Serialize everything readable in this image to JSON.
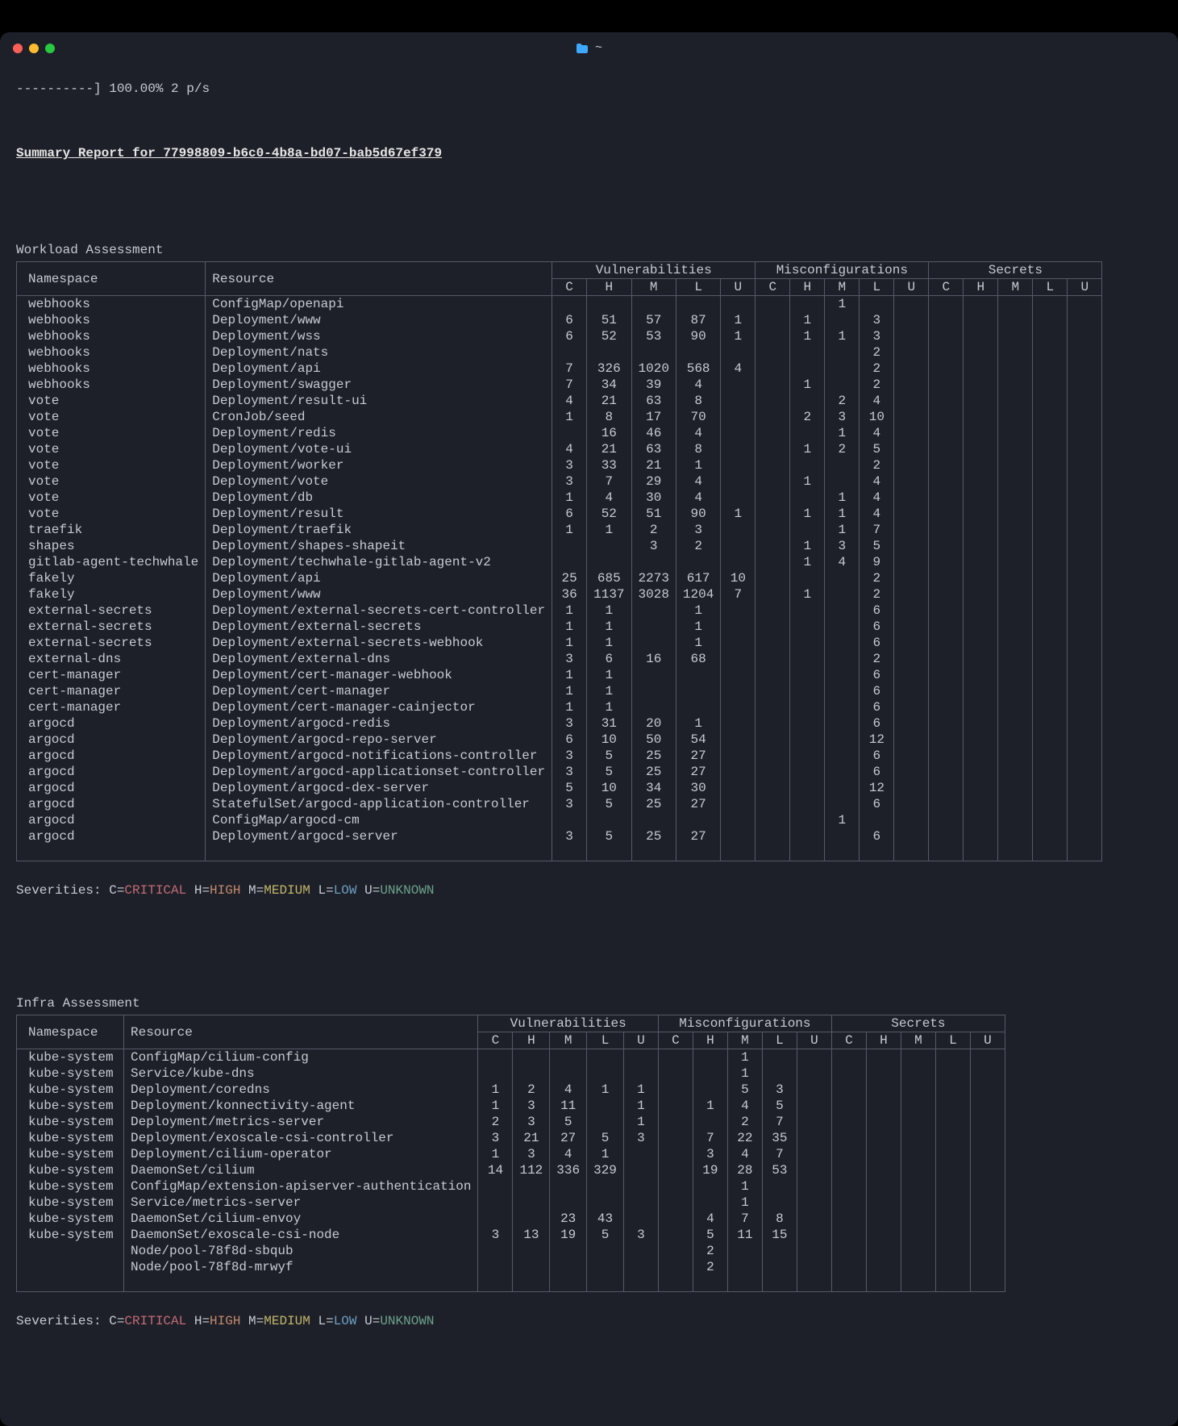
{
  "titlebar": {
    "colors": {
      "close": "#ff5f57",
      "min": "#febc2e",
      "max": "#28c840",
      "folder": "#3ea7ff"
    },
    "path": "~"
  },
  "progress_line": "----------] 100.00% 2 p/s",
  "report_title": "Summary Report for 77998809-b6c0-4b8a-bd07-bab5d67ef379",
  "workload_heading": "Workload Assessment",
  "infra_heading": "Infra Assessment",
  "headers": {
    "ns": "Namespace",
    "res": "Resource",
    "vuln": "Vulnerabilities",
    "mis": "Misconfigurations",
    "sec": "Secrets",
    "sev": [
      "C",
      "H",
      "M",
      "L",
      "U"
    ]
  },
  "legend": {
    "prefix": "Severities: ",
    "c_label": "C=",
    "c_val": "CRITICAL",
    "h_label": " H=",
    "h_val": "HIGH",
    "m_label": " M=",
    "m_val": "MEDIUM",
    "l_label": " L=",
    "l_val": "LOW",
    "u_label": " U=",
    "u_val": "UNKNOWN"
  },
  "workload_rows": [
    {
      "ns": "webhooks",
      "res": "ConfigMap/openapi",
      "v": [
        "",
        "",
        "",
        "",
        ""
      ],
      "m": [
        "",
        "",
        "1",
        "",
        ""
      ],
      "s": [
        "",
        "",
        "",
        "",
        ""
      ]
    },
    {
      "ns": "webhooks",
      "res": "Deployment/www",
      "v": [
        "6",
        "51",
        "57",
        "87",
        "1"
      ],
      "m": [
        "",
        "1",
        "",
        "3",
        ""
      ],
      "s": [
        "",
        "",
        "",
        "",
        ""
      ]
    },
    {
      "ns": "webhooks",
      "res": "Deployment/wss",
      "v": [
        "6",
        "52",
        "53",
        "90",
        "1"
      ],
      "m": [
        "",
        "1",
        "1",
        "3",
        ""
      ],
      "s": [
        "",
        "",
        "",
        "",
        ""
      ]
    },
    {
      "ns": "webhooks",
      "res": "Deployment/nats",
      "v": [
        "",
        "",
        "",
        "",
        ""
      ],
      "m": [
        "",
        "",
        "",
        "2",
        ""
      ],
      "s": [
        "",
        "",
        "",
        "",
        ""
      ]
    },
    {
      "ns": "webhooks",
      "res": "Deployment/api",
      "v": [
        "7",
        "326",
        "1020",
        "568",
        "4"
      ],
      "m": [
        "",
        "",
        "",
        "2",
        ""
      ],
      "s": [
        "",
        "",
        "",
        "",
        ""
      ]
    },
    {
      "ns": "webhooks",
      "res": "Deployment/swagger",
      "v": [
        "7",
        "34",
        "39",
        "4",
        ""
      ],
      "m": [
        "",
        "1",
        "",
        "2",
        ""
      ],
      "s": [
        "",
        "",
        "",
        "",
        ""
      ]
    },
    {
      "ns": "vote",
      "res": "Deployment/result-ui",
      "v": [
        "4",
        "21",
        "63",
        "8",
        ""
      ],
      "m": [
        "",
        "",
        "2",
        "4",
        ""
      ],
      "s": [
        "",
        "",
        "",
        "",
        ""
      ]
    },
    {
      "ns": "vote",
      "res": "CronJob/seed",
      "v": [
        "1",
        "8",
        "17",
        "70",
        ""
      ],
      "m": [
        "",
        "2",
        "3",
        "10",
        ""
      ],
      "s": [
        "",
        "",
        "",
        "",
        ""
      ]
    },
    {
      "ns": "vote",
      "res": "Deployment/redis",
      "v": [
        "",
        "16",
        "46",
        "4",
        ""
      ],
      "m": [
        "",
        "",
        "1",
        "4",
        ""
      ],
      "s": [
        "",
        "",
        "",
        "",
        ""
      ]
    },
    {
      "ns": "vote",
      "res": "Deployment/vote-ui",
      "v": [
        "4",
        "21",
        "63",
        "8",
        ""
      ],
      "m": [
        "",
        "1",
        "2",
        "5",
        ""
      ],
      "s": [
        "",
        "",
        "",
        "",
        ""
      ]
    },
    {
      "ns": "vote",
      "res": "Deployment/worker",
      "v": [
        "3",
        "33",
        "21",
        "1",
        ""
      ],
      "m": [
        "",
        "",
        "",
        "2",
        ""
      ],
      "s": [
        "",
        "",
        "",
        "",
        ""
      ]
    },
    {
      "ns": "vote",
      "res": "Deployment/vote",
      "v": [
        "3",
        "7",
        "29",
        "4",
        ""
      ],
      "m": [
        "",
        "1",
        "",
        "4",
        ""
      ],
      "s": [
        "",
        "",
        "",
        "",
        ""
      ]
    },
    {
      "ns": "vote",
      "res": "Deployment/db",
      "v": [
        "1",
        "4",
        "30",
        "4",
        ""
      ],
      "m": [
        "",
        "",
        "1",
        "4",
        ""
      ],
      "s": [
        "",
        "",
        "",
        "",
        ""
      ]
    },
    {
      "ns": "vote",
      "res": "Deployment/result",
      "v": [
        "6",
        "52",
        "51",
        "90",
        "1"
      ],
      "m": [
        "",
        "1",
        "1",
        "4",
        ""
      ],
      "s": [
        "",
        "",
        "",
        "",
        ""
      ]
    },
    {
      "ns": "traefik",
      "res": "Deployment/traefik",
      "v": [
        "1",
        "1",
        "2",
        "3",
        ""
      ],
      "m": [
        "",
        "",
        "1",
        "7",
        ""
      ],
      "s": [
        "",
        "",
        "",
        "",
        ""
      ]
    },
    {
      "ns": "shapes",
      "res": "Deployment/shapes-shapeit",
      "v": [
        "",
        "",
        "3",
        "2",
        ""
      ],
      "m": [
        "",
        "1",
        "3",
        "5",
        ""
      ],
      "s": [
        "",
        "",
        "",
        "",
        ""
      ]
    },
    {
      "ns": "gitlab-agent-techwhale",
      "res": "Deployment/techwhale-gitlab-agent-v2",
      "v": [
        "",
        "",
        "",
        "",
        ""
      ],
      "m": [
        "",
        "1",
        "4",
        "9",
        ""
      ],
      "s": [
        "",
        "",
        "",
        "",
        ""
      ]
    },
    {
      "ns": "fakely",
      "res": "Deployment/api",
      "v": [
        "25",
        "685",
        "2273",
        "617",
        "10"
      ],
      "m": [
        "",
        "",
        "",
        "2",
        ""
      ],
      "s": [
        "",
        "",
        "",
        "",
        ""
      ]
    },
    {
      "ns": "fakely",
      "res": "Deployment/www",
      "v": [
        "36",
        "1137",
        "3028",
        "1204",
        "7"
      ],
      "m": [
        "",
        "1",
        "",
        "2",
        ""
      ],
      "s": [
        "",
        "",
        "",
        "",
        ""
      ]
    },
    {
      "ns": "external-secrets",
      "res": "Deployment/external-secrets-cert-controller",
      "v": [
        "1",
        "1",
        "",
        "1",
        ""
      ],
      "m": [
        "",
        "",
        "",
        "6",
        ""
      ],
      "s": [
        "",
        "",
        "",
        "",
        ""
      ]
    },
    {
      "ns": "external-secrets",
      "res": "Deployment/external-secrets",
      "v": [
        "1",
        "1",
        "",
        "1",
        ""
      ],
      "m": [
        "",
        "",
        "",
        "6",
        ""
      ],
      "s": [
        "",
        "",
        "",
        "",
        ""
      ]
    },
    {
      "ns": "external-secrets",
      "res": "Deployment/external-secrets-webhook",
      "v": [
        "1",
        "1",
        "",
        "1",
        ""
      ],
      "m": [
        "",
        "",
        "",
        "6",
        ""
      ],
      "s": [
        "",
        "",
        "",
        "",
        ""
      ]
    },
    {
      "ns": "external-dns",
      "res": "Deployment/external-dns",
      "v": [
        "3",
        "6",
        "16",
        "68",
        ""
      ],
      "m": [
        "",
        "",
        "",
        "2",
        ""
      ],
      "s": [
        "",
        "",
        "",
        "",
        ""
      ]
    },
    {
      "ns": "cert-manager",
      "res": "Deployment/cert-manager-webhook",
      "v": [
        "1",
        "1",
        "",
        "",
        ""
      ],
      "m": [
        "",
        "",
        "",
        "6",
        ""
      ],
      "s": [
        "",
        "",
        "",
        "",
        ""
      ]
    },
    {
      "ns": "cert-manager",
      "res": "Deployment/cert-manager",
      "v": [
        "1",
        "1",
        "",
        "",
        ""
      ],
      "m": [
        "",
        "",
        "",
        "6",
        ""
      ],
      "s": [
        "",
        "",
        "",
        "",
        ""
      ]
    },
    {
      "ns": "cert-manager",
      "res": "Deployment/cert-manager-cainjector",
      "v": [
        "1",
        "1",
        "",
        "",
        ""
      ],
      "m": [
        "",
        "",
        "",
        "6",
        ""
      ],
      "s": [
        "",
        "",
        "",
        "",
        ""
      ]
    },
    {
      "ns": "argocd",
      "res": "Deployment/argocd-redis",
      "v": [
        "3",
        "31",
        "20",
        "1",
        ""
      ],
      "m": [
        "",
        "",
        "",
        "6",
        ""
      ],
      "s": [
        "",
        "",
        "",
        "",
        ""
      ]
    },
    {
      "ns": "argocd",
      "res": "Deployment/argocd-repo-server",
      "v": [
        "6",
        "10",
        "50",
        "54",
        ""
      ],
      "m": [
        "",
        "",
        "",
        "12",
        ""
      ],
      "s": [
        "",
        "",
        "",
        "",
        ""
      ]
    },
    {
      "ns": "argocd",
      "res": "Deployment/argocd-notifications-controller",
      "v": [
        "3",
        "5",
        "25",
        "27",
        ""
      ],
      "m": [
        "",
        "",
        "",
        "6",
        ""
      ],
      "s": [
        "",
        "",
        "",
        "",
        ""
      ]
    },
    {
      "ns": "argocd",
      "res": "Deployment/argocd-applicationset-controller",
      "v": [
        "3",
        "5",
        "25",
        "27",
        ""
      ],
      "m": [
        "",
        "",
        "",
        "6",
        ""
      ],
      "s": [
        "",
        "",
        "",
        "",
        ""
      ]
    },
    {
      "ns": "argocd",
      "res": "Deployment/argocd-dex-server",
      "v": [
        "5",
        "10",
        "34",
        "30",
        ""
      ],
      "m": [
        "",
        "",
        "",
        "12",
        ""
      ],
      "s": [
        "",
        "",
        "",
        "",
        ""
      ]
    },
    {
      "ns": "argocd",
      "res": "StatefulSet/argocd-application-controller",
      "v": [
        "3",
        "5",
        "25",
        "27",
        ""
      ],
      "m": [
        "",
        "",
        "",
        "6",
        ""
      ],
      "s": [
        "",
        "",
        "",
        "",
        ""
      ]
    },
    {
      "ns": "argocd",
      "res": "ConfigMap/argocd-cm",
      "v": [
        "",
        "",
        "",
        "",
        ""
      ],
      "m": [
        "",
        "",
        "1",
        "",
        ""
      ],
      "s": [
        "",
        "",
        "",
        "",
        ""
      ]
    },
    {
      "ns": "argocd",
      "res": "Deployment/argocd-server",
      "v": [
        "3",
        "5",
        "25",
        "27",
        ""
      ],
      "m": [
        "",
        "",
        "",
        "6",
        ""
      ],
      "s": [
        "",
        "",
        "",
        "",
        ""
      ]
    }
  ],
  "infra_rows": [
    {
      "ns": "kube-system",
      "res": "ConfigMap/cilium-config",
      "v": [
        "",
        "",
        "",
        "",
        ""
      ],
      "m": [
        "",
        "",
        "1",
        "",
        ""
      ],
      "s": [
        "",
        "",
        "",
        "",
        ""
      ]
    },
    {
      "ns": "kube-system",
      "res": "Service/kube-dns",
      "v": [
        "",
        "",
        "",
        "",
        ""
      ],
      "m": [
        "",
        "",
        "1",
        "",
        ""
      ],
      "s": [
        "",
        "",
        "",
        "",
        ""
      ]
    },
    {
      "ns": "kube-system",
      "res": "Deployment/coredns",
      "v": [
        "1",
        "2",
        "4",
        "1",
        "1"
      ],
      "m": [
        "",
        "",
        "5",
        "3",
        ""
      ],
      "s": [
        "",
        "",
        "",
        "",
        ""
      ]
    },
    {
      "ns": "kube-system",
      "res": "Deployment/konnectivity-agent",
      "v": [
        "1",
        "3",
        "11",
        "",
        "1"
      ],
      "m": [
        "",
        "1",
        "4",
        "5",
        ""
      ],
      "s": [
        "",
        "",
        "",
        "",
        ""
      ]
    },
    {
      "ns": "kube-system",
      "res": "Deployment/metrics-server",
      "v": [
        "2",
        "3",
        "5",
        "",
        "1"
      ],
      "m": [
        "",
        "",
        "2",
        "7",
        ""
      ],
      "s": [
        "",
        "",
        "",
        "",
        ""
      ]
    },
    {
      "ns": "kube-system",
      "res": "Deployment/exoscale-csi-controller",
      "v": [
        "3",
        "21",
        "27",
        "5",
        "3"
      ],
      "m": [
        "",
        "7",
        "22",
        "35",
        ""
      ],
      "s": [
        "",
        "",
        "",
        "",
        ""
      ]
    },
    {
      "ns": "kube-system",
      "res": "Deployment/cilium-operator",
      "v": [
        "1",
        "3",
        "4",
        "1",
        ""
      ],
      "m": [
        "",
        "3",
        "4",
        "7",
        ""
      ],
      "s": [
        "",
        "",
        "",
        "",
        ""
      ]
    },
    {
      "ns": "kube-system",
      "res": "DaemonSet/cilium",
      "v": [
        "14",
        "112",
        "336",
        "329",
        ""
      ],
      "m": [
        "",
        "19",
        "28",
        "53",
        ""
      ],
      "s": [
        "",
        "",
        "",
        "",
        ""
      ]
    },
    {
      "ns": "kube-system",
      "res": "ConfigMap/extension-apiserver-authentication",
      "v": [
        "",
        "",
        "",
        "",
        ""
      ],
      "m": [
        "",
        "",
        "1",
        "",
        ""
      ],
      "s": [
        "",
        "",
        "",
        "",
        ""
      ]
    },
    {
      "ns": "kube-system",
      "res": "Service/metrics-server",
      "v": [
        "",
        "",
        "",
        "",
        ""
      ],
      "m": [
        "",
        "",
        "1",
        "",
        ""
      ],
      "s": [
        "",
        "",
        "",
        "",
        ""
      ]
    },
    {
      "ns": "kube-system",
      "res": "DaemonSet/cilium-envoy",
      "v": [
        "",
        "",
        "23",
        "43",
        ""
      ],
      "m": [
        "",
        "4",
        "7",
        "8",
        ""
      ],
      "s": [
        "",
        "",
        "",
        "",
        ""
      ]
    },
    {
      "ns": "kube-system",
      "res": "DaemonSet/exoscale-csi-node",
      "v": [
        "3",
        "13",
        "19",
        "5",
        "3"
      ],
      "m": [
        "",
        "5",
        "11",
        "15",
        ""
      ],
      "s": [
        "",
        "",
        "",
        "",
        ""
      ]
    },
    {
      "ns": "",
      "res": "Node/pool-78f8d-sbqub",
      "v": [
        "",
        "",
        "",
        "",
        ""
      ],
      "m": [
        "",
        "2",
        "",
        "",
        ""
      ],
      "s": [
        "",
        "",
        "",
        "",
        ""
      ]
    },
    {
      "ns": "",
      "res": "Node/pool-78f8d-mrwyf",
      "v": [
        "",
        "",
        "",
        "",
        ""
      ],
      "m": [
        "",
        "2",
        "",
        "",
        ""
      ],
      "s": [
        "",
        "",
        "",
        "",
        ""
      ]
    }
  ]
}
